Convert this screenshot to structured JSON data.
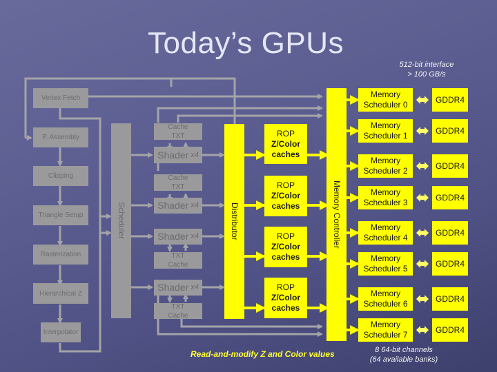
{
  "slide": {
    "title": "Today’s GPUs",
    "interface_note": [
      "512-bit interface",
      "> 100 GB/s"
    ],
    "channels_note": [
      "8 64-bit channels",
      "(64 available banks)"
    ],
    "rmw_note": "Read-and-modify Z and Color values"
  },
  "pipeline": {
    "vertex_fetch": "Vertex Fetch",
    "p_assembly": "P. Assembly",
    "clipping": "Clipping",
    "triangle_setup": "Triangle Setup",
    "rasterization": "Rasterization",
    "hierarchical_z": "Hierarchical Z",
    "interpolator": "Interpolator"
  },
  "scheduler_label": "Scheduler",
  "distributor_label": "Distributor",
  "memory_controller_label": "Memory Controller",
  "shader": {
    "label": "Shader",
    "multiplier": "x4"
  },
  "caches": {
    "cache_txt": [
      "Cache",
      "TXT"
    ],
    "txt_cache": [
      "TXT",
      "Cache"
    ]
  },
  "rop": {
    "line1": "ROP",
    "line2": "Z/Color",
    "line3": "caches"
  },
  "memory_schedulers": [
    {
      "line1": "Memory",
      "line2": "Scheduler 0",
      "dram": "GDDR4"
    },
    {
      "line1": "Memory",
      "line2": "Scheduler 1",
      "dram": "GDDR4"
    },
    {
      "line1": "Memory",
      "line2": "Scheduler 2",
      "dram": "GDDR4"
    },
    {
      "line1": "Memory",
      "line2": "Scheduler 3",
      "dram": "GDDR4"
    },
    {
      "line1": "Memory",
      "line2": "Scheduler 4",
      "dram": "GDDR4"
    },
    {
      "line1": "Memory",
      "line2": "Scheduler 5",
      "dram": "GDDR4"
    },
    {
      "line1": "Memory",
      "line2": "Scheduler 6",
      "dram": "GDDR4"
    },
    {
      "line1": "Memory",
      "line2": "Scheduler 7",
      "dram": "GDDR4"
    }
  ],
  "colors": {
    "gray_block": "#9a9a9c",
    "yellow_block": "#ffff00",
    "wire_gray": "#a4a4a8"
  }
}
